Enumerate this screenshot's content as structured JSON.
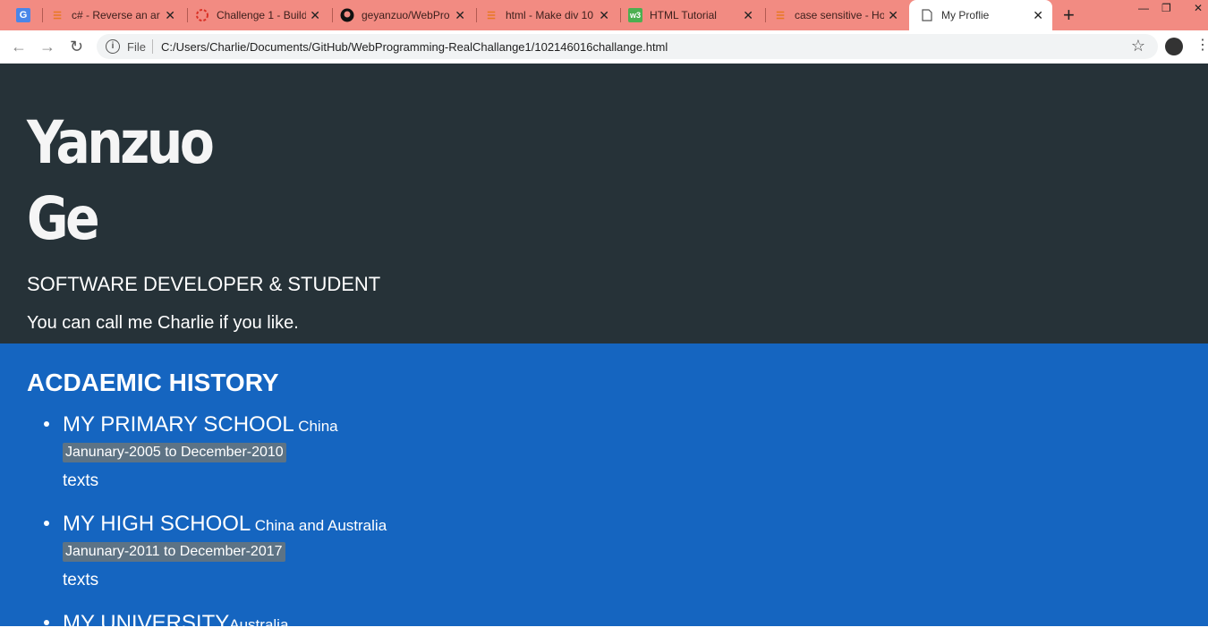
{
  "browser": {
    "tabs": [
      {
        "title": "",
        "icon": "google-translate-icon"
      },
      {
        "title": "c# - Reverse an ar",
        "icon": "stackoverflow-icon"
      },
      {
        "title": "Challenge 1 - Build",
        "icon": "loading-icon"
      },
      {
        "title": "geyanzuo/WebPro",
        "icon": "github-icon"
      },
      {
        "title": "html - Make div 10",
        "icon": "stackoverflow-icon"
      },
      {
        "title": "HTML Tutorial",
        "icon": "w3schools-icon"
      },
      {
        "title": "case sensitive - Ho",
        "icon": "stackoverflow-icon"
      },
      {
        "title": "My Proflie",
        "icon": "document-icon"
      }
    ],
    "address": {
      "scheme_label": "File",
      "url": "C:/Users/Charlie/Documents/GitHub/WebProgramming-RealChallange1/102146016challange.html"
    }
  },
  "profile": {
    "first_name": "Yanzuo",
    "last_name": "Ge",
    "role": "SOFTWARE DEVELOPER & STUDENT",
    "callme": "You can call me Charlie if you like."
  },
  "academic": {
    "title": "ACDAEMIC HISTORY",
    "schools": [
      {
        "name": "MY PRIMARY SCHOOL",
        "location": "China",
        "dates": "Janunary-2005 to December-2010",
        "text": "texts"
      },
      {
        "name": "MY HIGH SCHOOL",
        "location": "China and Australia",
        "dates": "Janunary-2011 to December-2017",
        "text": "texts"
      },
      {
        "name": "MY UNIVERSITY",
        "location": "Australia"
      }
    ]
  },
  "colors": {
    "tabstrip": "#f28b82",
    "hero_bg": "#263238",
    "academic_bg": "#1565c0",
    "date_badge": "#5d7385"
  }
}
